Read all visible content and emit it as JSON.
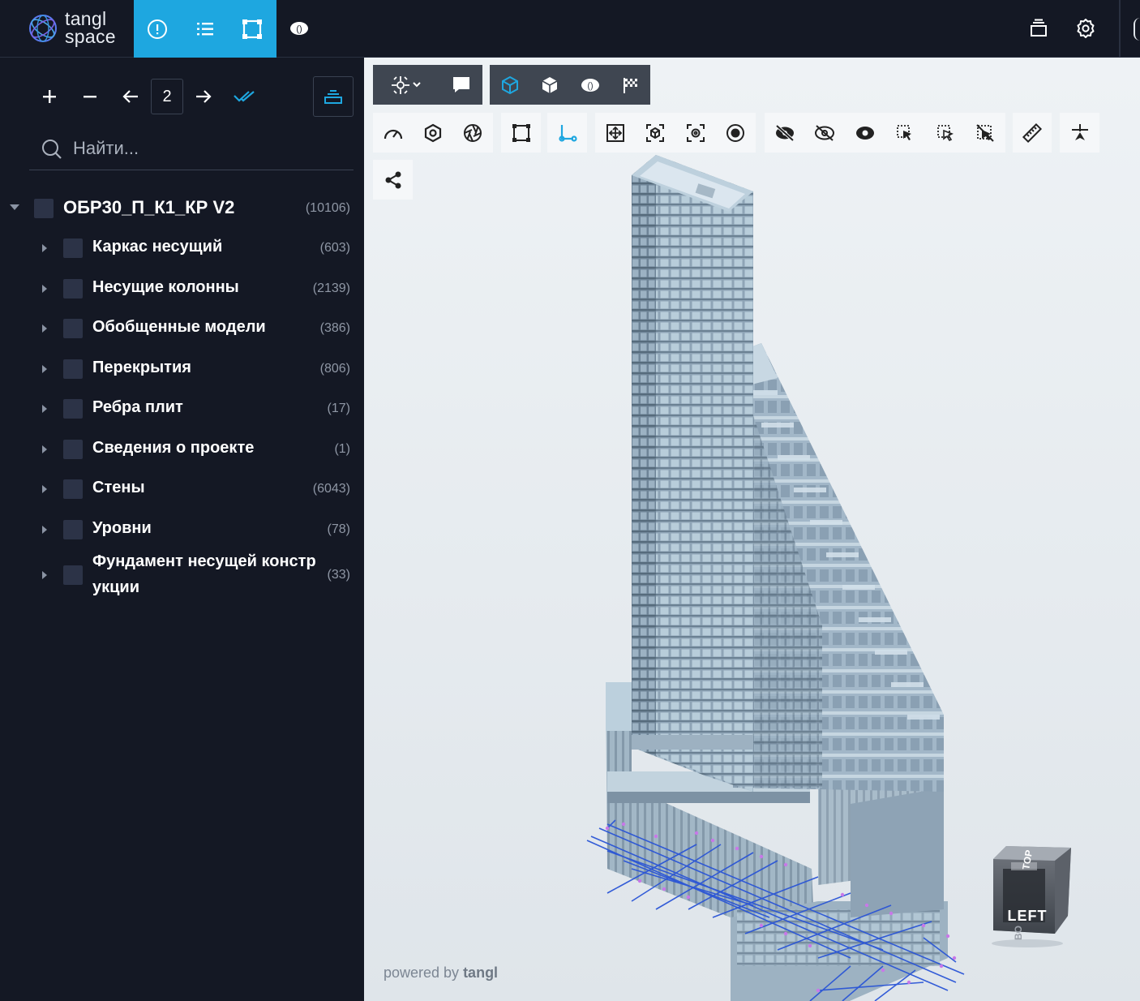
{
  "app": {
    "logo_line1": "tangl",
    "logo_line2": "space"
  },
  "topnav": {
    "items": [
      {
        "name": "info",
        "icon": "info-circle-icon",
        "active": true
      },
      {
        "name": "list",
        "icon": "list-icon",
        "active": true
      },
      {
        "name": "frame",
        "icon": "frame-select-icon",
        "active": true
      }
    ],
    "eye_icon": "eye-toggle-icon",
    "right": [
      "stack-icon",
      "gear-icon"
    ],
    "accent_color": "#1ea7e0"
  },
  "sidebar": {
    "toolbar": {
      "expand": "+",
      "collapse": "−",
      "page_value": "2"
    },
    "search": {
      "placeholder": "Найти..."
    },
    "root": {
      "label": "ОБР30_П_К1_КР V2",
      "count": "(10106)"
    },
    "items": [
      {
        "label": "Каркас несущий",
        "count": "(603)"
      },
      {
        "label": "Несущие колонны",
        "count": "(2139)"
      },
      {
        "label": "Обобщенные модели",
        "count": "(386)"
      },
      {
        "label": "Перекрытия",
        "count": "(806)"
      },
      {
        "label": "Ребра плит",
        "count": "(17)"
      },
      {
        "label": "Сведения о проекте",
        "count": "(1)"
      },
      {
        "label": "Стены",
        "count": "(6043)"
      },
      {
        "label": "Уровни",
        "count": "(78)"
      },
      {
        "label_line1": "Фундамент несущей констр",
        "label_line2": "укции",
        "count": "(33)"
      }
    ]
  },
  "viewer": {
    "powered_prefix": "powered by ",
    "powered_brand": "tangl",
    "navcube": {
      "face_front": "LEFT",
      "face_top": "TOP",
      "face_side": "BO"
    }
  }
}
